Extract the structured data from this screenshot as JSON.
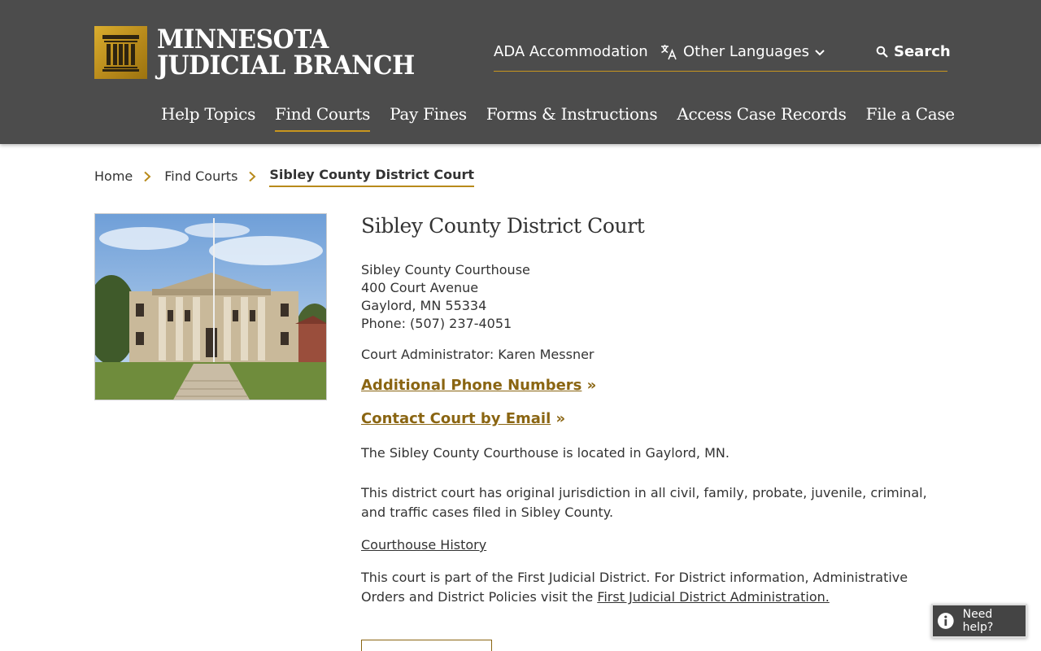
{
  "header": {
    "logo_line1": "MINNESOTA",
    "logo_line2": "JUDICIAL BRANCH",
    "utility": {
      "ada": "ADA Accommodation",
      "languages": "Other Languages",
      "search": "Search"
    },
    "nav": [
      {
        "label": "Help Topics",
        "active": false
      },
      {
        "label": "Find Courts",
        "active": true
      },
      {
        "label": "Pay Fines",
        "active": false
      },
      {
        "label": "Forms & Instructions",
        "active": false
      },
      {
        "label": "Access Case Records",
        "active": false
      },
      {
        "label": "File a Case",
        "active": false
      }
    ]
  },
  "breadcrumb": {
    "home": "Home",
    "parent": "Find Courts",
    "current": "Sibley County District Court"
  },
  "court": {
    "title": "Sibley County District Court",
    "address": {
      "building": "Sibley County Courthouse",
      "street": "400 Court Avenue",
      "city_state_zip": "Gaylord, MN 55334",
      "phone": "Phone: (507) 237-4051"
    },
    "administrator": "Court Administrator: Karen Messner",
    "links": {
      "phone_numbers": "Additional Phone Numbers",
      "email": "Contact Court by Email",
      "arrow": "»"
    },
    "location_text": "The Sibley County Courthouse is located in Gaylord, MN.",
    "jurisdiction_text": "This district court has original jurisdiction in all civil, family, probate, juvenile, criminal, and traffic cases filed in Sibley County.",
    "history_link": "Courthouse History",
    "district_text": "This court is part of the First Judicial District. For District information, Administrative Orders and District Policies visit the",
    "district_link": "First Judicial District Administration."
  },
  "help_widget": {
    "label": "Need help?"
  },
  "colors": {
    "header_bg": "#4c4c4c",
    "accent_gold": "#c8961e",
    "link_gold": "#8a6512"
  }
}
